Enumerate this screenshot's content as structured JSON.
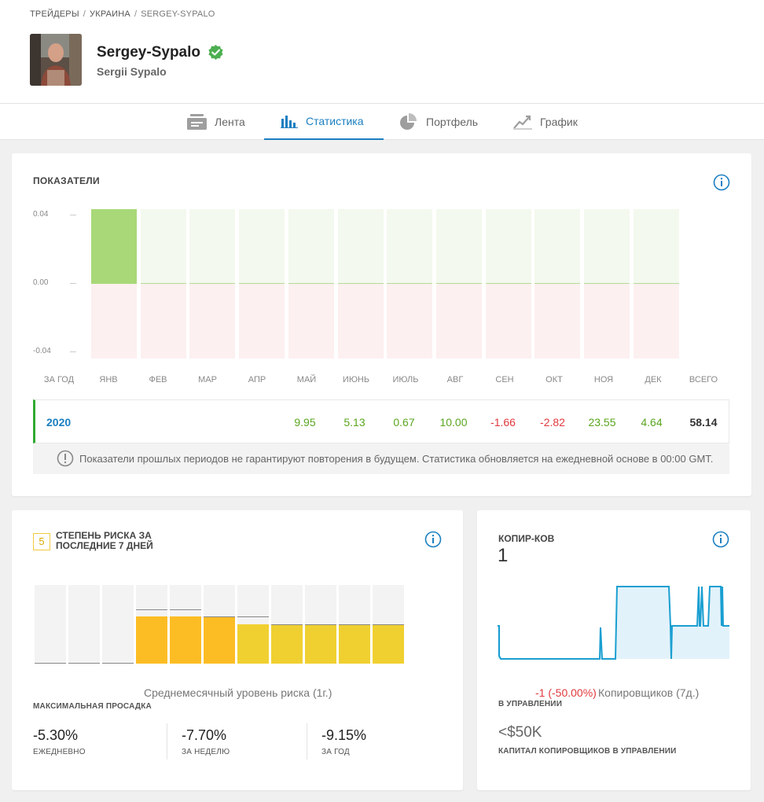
{
  "breadcrumb": {
    "items": [
      "ТРЕЙДЕРЫ",
      "УКРАИНА",
      "SERGEY-SYPALO"
    ]
  },
  "profile": {
    "username": "Sergey-Sypalo",
    "real_name": "Sergii Sypalo",
    "verified": true
  },
  "tabs": [
    {
      "label": "Лента",
      "icon": "feed-icon",
      "active": false
    },
    {
      "label": "Статистика",
      "icon": "bar-chart-icon",
      "active": true
    },
    {
      "label": "Портфель",
      "icon": "pie-chart-icon",
      "active": false
    },
    {
      "label": "График",
      "icon": "line-chart-icon",
      "active": false
    }
  ],
  "stats": {
    "title": "ПОКАЗАТЕЛИ",
    "year": "2020",
    "values": [
      "9.95",
      "5.13",
      "0.67",
      "10.00",
      "-1.66",
      "-2.82",
      "23.55",
      "4.64"
    ],
    "total": "58.14",
    "notice": "Показатели прошлых периодов не гарантируют повторения в будущем. Статистика обновляется на ежедневной основе в 00:00 GMT."
  },
  "chart_data": {
    "type": "bar",
    "title": "",
    "yticks": [
      "0.04",
      "0.00",
      "-0.04"
    ],
    "ylim": [
      -0.04,
      0.04
    ],
    "categories": [
      "ЗА ГОД",
      "ЯНВ",
      "ФЕВ",
      "МАР",
      "АПР",
      "МАЙ",
      "ИЮНЬ",
      "ИЮЛЬ",
      "АВГ",
      "СЕН",
      "ОКТ",
      "НОЯ",
      "ДЕК",
      "ВСЕГО"
    ],
    "bar_months": [
      "ЯНВ",
      "ФЕВ",
      "МАР",
      "АПР",
      "МАЙ",
      "ИЮНЬ",
      "ИЮЛЬ",
      "АВГ",
      "СЕН",
      "ОКТ",
      "НОЯ",
      "ДЕК"
    ],
    "values": [
      0.044,
      0.0,
      0.0,
      0.0,
      0.0,
      0.0,
      0.0,
      0.0005,
      0.0,
      0.0,
      0.0,
      0.0
    ],
    "colors": {
      "positive": "#a8d878",
      "positive_bg": "#f3f9ee",
      "negative_bg": "#fdf0f0"
    }
  },
  "risk": {
    "score": "5",
    "title": "СТЕПЕНЬ РИСКА ЗА ПОСЛЕДНИЕ 7 ДНЕЙ",
    "avg_label": "Среднемесячный уровень риска (1г.)",
    "bars": [
      {
        "level": 0,
        "max": 0
      },
      {
        "level": 0,
        "max": 0
      },
      {
        "level": 0,
        "max": 0
      },
      {
        "level": 0.6,
        "max": 0.69
      },
      {
        "level": 0.6,
        "max": 0.69
      },
      {
        "level": 0.6,
        "max": 0.6
      },
      {
        "level": 0.5,
        "max": 0.6
      },
      {
        "level": 0.5,
        "max": 0.5
      },
      {
        "level": 0.5,
        "max": 0.5
      },
      {
        "level": 0.5,
        "max": 0.5
      },
      {
        "level": 0.5,
        "max": 0.5
      }
    ],
    "colors": {
      "high": "#fcbd24",
      "mid": "#f0d030"
    }
  },
  "drawdown": {
    "title": "МАКСИМАЛЬНАЯ ПРОСАДКА",
    "daily": {
      "value": "-5.30%",
      "label": "ЕЖЕДНЕВНО"
    },
    "weekly": {
      "value": "-7.70%",
      "label": "ЗА НЕДЕЛЮ"
    },
    "yearly": {
      "value": "-9.15%",
      "label": "ЗА ГОД"
    }
  },
  "copiers": {
    "title": "КОПИР-КОВ",
    "count": "1",
    "change": "-1 (-50.00%)",
    "change_label": "Копировщиков (7д.)",
    "aum_label": "В УПРАВЛЕНИИ",
    "aum_value": "<$50K",
    "aum_caption": "КАПИТАЛ КОПИРОВЩИКОВ В УПРАВЛЕНИИ"
  }
}
